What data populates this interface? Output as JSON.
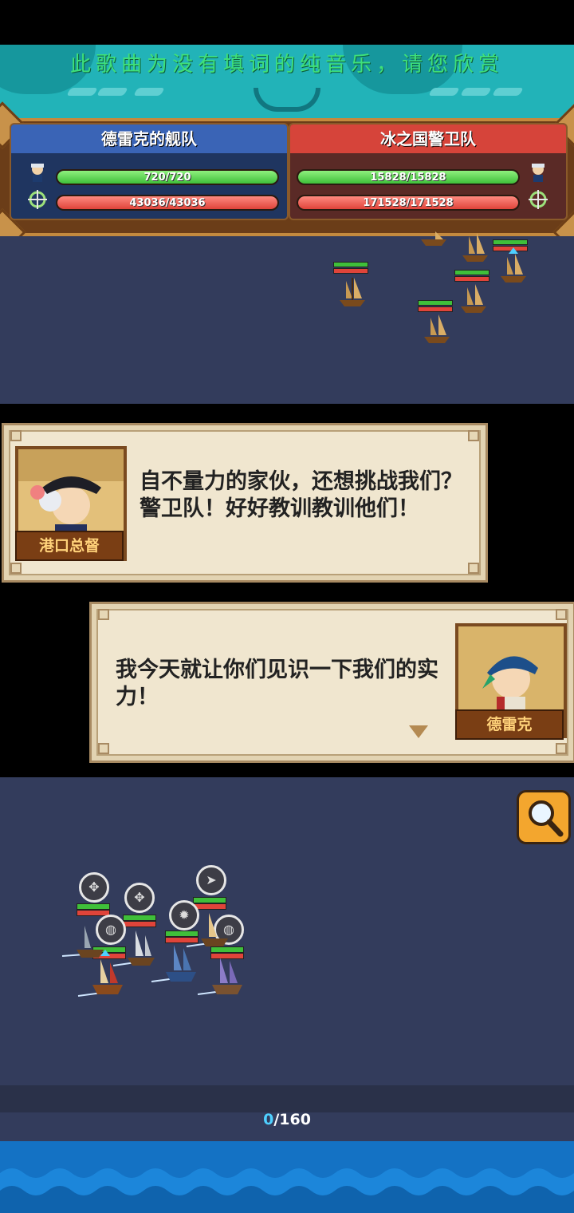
{
  "banner": {
    "lyric": "此歌曲为没有填词的纯音乐，请您欣赏"
  },
  "hud": {
    "left_team": {
      "name": "德雷克的舰队",
      "crew": "720/720",
      "hull": "43036/43036",
      "crew_ratio": 1.0,
      "hull_ratio": 1.0
    },
    "right_team": {
      "name": "冰之国警卫队",
      "crew": "15828/15828",
      "hull": "171528/171528",
      "crew_ratio": 1.0,
      "hull_ratio": 1.0
    }
  },
  "dialogs": [
    {
      "speaker": "港口总督",
      "text": "自不量力的家伙，还想挑战我们？警卫队！好好教训教训他们！"
    },
    {
      "speaker": "德雷克",
      "text": "我今天就让你们见识一下我们的实力！"
    }
  ],
  "progress": {
    "current": "0",
    "total": "/160"
  },
  "icons": {
    "magnifier": "magnifier-icon",
    "crew": "sailor-icon",
    "hull": "ship-wheel-icon"
  },
  "colors": {
    "banner": "#22b3b8",
    "lyric": "#3fe07a",
    "sea": "#333c5c",
    "hp_green": "#3fbf3a",
    "hp_red": "#e0443a"
  }
}
